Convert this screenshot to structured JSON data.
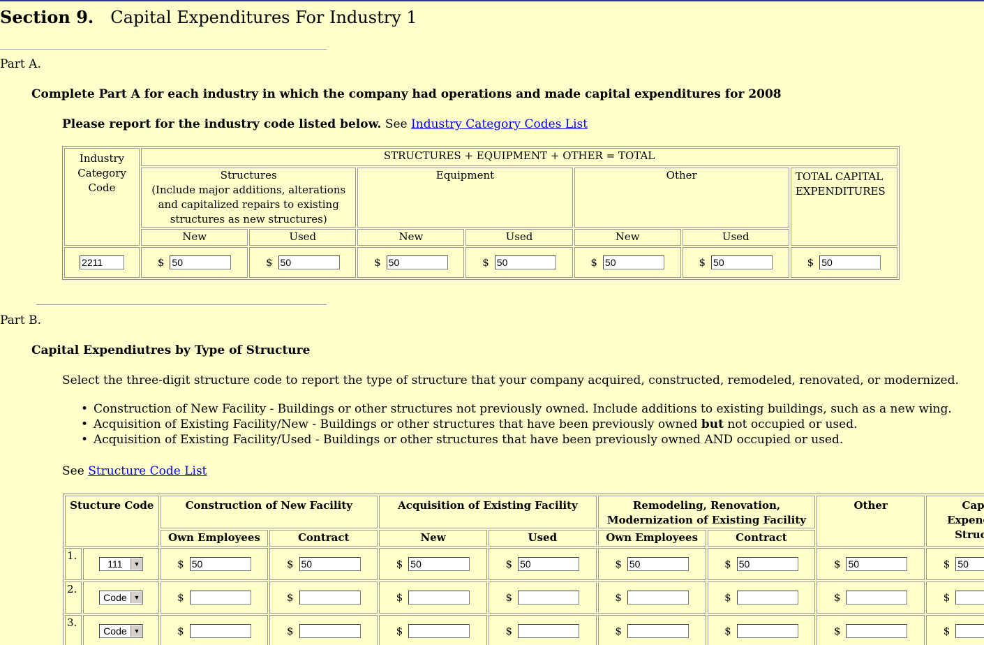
{
  "section": {
    "number": "Section 9.",
    "title": "Capital Expenditures For Industry 1"
  },
  "partA": {
    "label": "Part A.",
    "heading": "Complete Part A for each industry in which the company had operations and made capital expenditures for 2008",
    "instruction": "Please report for the industry code listed below.",
    "see": "See",
    "link": "Industry Category Codes List",
    "table": {
      "col_industry": "Industry Category Code",
      "formula": "STRUCTURES + EQUIPMENT + OTHER = TOTAL",
      "structures_title": "Structures",
      "structures_note": "(Include major additions, alterations and capitalized repairs to existing structures as new structures)",
      "equipment": "Equipment",
      "other": "Other",
      "total": "TOTAL CAPITAL EXPENDITURES",
      "new": "New",
      "used": "Used",
      "currency": "$",
      "industry_code": "2211",
      "values": [
        "50",
        "50",
        "50",
        "50",
        "50",
        "50",
        "50"
      ]
    }
  },
  "partB": {
    "label": "Part B.",
    "heading": "Capital Expendiutres by Type of Structure",
    "instruction": "Select the three-digit structure code to report the type of structure that your company acquired, constructed, remodeled, renovated, or modernized.",
    "bullets": [
      "Construction of New Facility - Buildings or other structures not previously owned. Include additions to existing buildings, such as a new wing.",
      {
        "before": "Acquisition of Existing Facility/New - Buildings or other structures that have been previously owned ",
        "bold": "but",
        "after": " not occupied or used."
      },
      "Acquisition of Existing Facility/Used - Buildings or other structures that have been previously owned AND occupied or used."
    ],
    "see": "See",
    "link": "Structure Code List",
    "table": {
      "structure_code": "Stucture Code",
      "construction": "Construction of New Facility",
      "acquisition": "Acquisition of Existing Facility",
      "remodel": "Remodeling, Renovation, Modernization of Existing Facility",
      "other": "Other",
      "capital": "Capital Expenditure Structure",
      "own_employees": "Own Employees",
      "contract": "Contract",
      "new": "New",
      "used": "Used",
      "currency": "$",
      "rows": [
        {
          "num": "1.",
          "code": "111",
          "values": [
            "50",
            "50",
            "50",
            "50",
            "50",
            "50",
            "50",
            "50"
          ]
        },
        {
          "num": "2.",
          "code": "Code",
          "values": [
            "",
            "",
            "",
            "",
            "",
            "",
            "",
            ""
          ]
        },
        {
          "num": "3.",
          "code": "Code",
          "values": [
            "",
            "",
            "",
            "",
            "",
            "",
            "",
            ""
          ]
        }
      ]
    }
  }
}
